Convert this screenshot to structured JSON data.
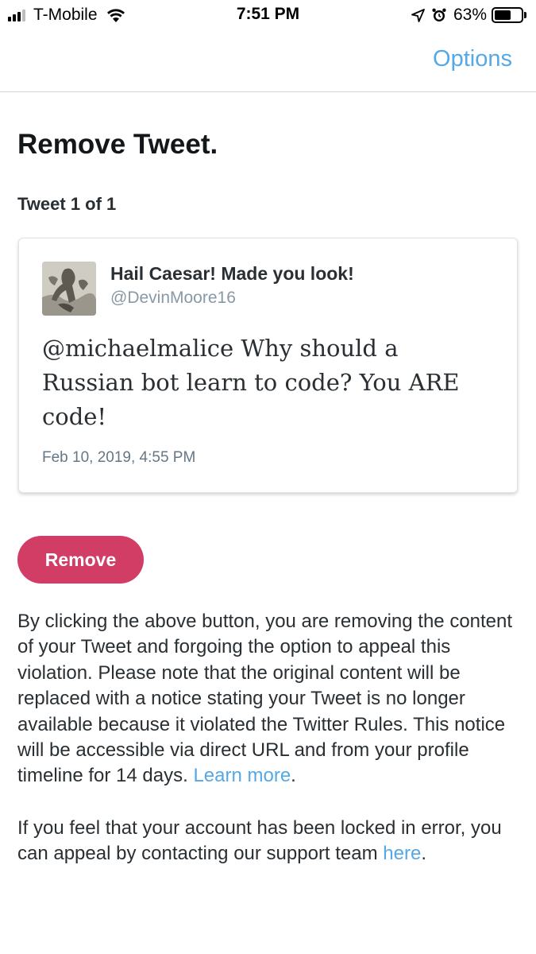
{
  "status_bar": {
    "carrier": "T-Mobile",
    "time": "7:51 PM",
    "battery_percent": "63%",
    "battery_level": 0.63,
    "icons": [
      "signal-icon",
      "wifi-icon",
      "location-icon",
      "alarm-icon",
      "battery-icon"
    ]
  },
  "nav": {
    "options_label": "Options"
  },
  "page": {
    "title": "Remove Tweet.",
    "tweet_count": "Tweet 1 of 1"
  },
  "tweet": {
    "display_name": "Hail Caesar! Made you look!",
    "handle": "@DevinMoore16",
    "text": "@michaelmalice Why should a Russian bot learn to code? You ARE code!",
    "date": "Feb 10, 2019, 4:55 PM"
  },
  "actions": {
    "remove_label": "Remove"
  },
  "notice": {
    "text": "By clicking the above button, you are removing the content of your Tweet and forgoing the option to appeal this violation. Please note that the original content will be replaced with a notice stating your Tweet is no longer available because it violated the Twitter Rules. This notice will be accessible via direct URL and from your profile timeline for 14 days. ",
    "learn_more_label": "Learn more",
    "after_link": "."
  },
  "appeal": {
    "text": "If you feel that your account has been locked in error, you can appeal by contacting our support team ",
    "here_label": "here",
    "after_link": "."
  },
  "colors": {
    "link": "#55a8e6",
    "remove_button": "#d13d64",
    "text": "#14171a"
  }
}
